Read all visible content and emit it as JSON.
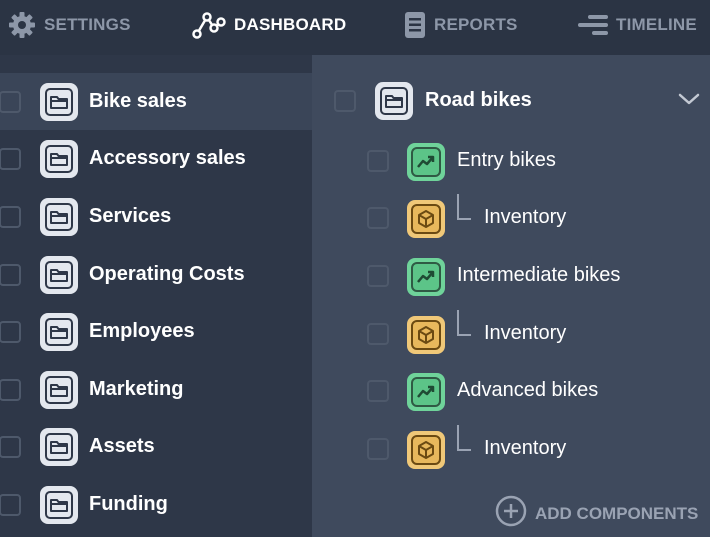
{
  "topnav": {
    "tabs": [
      {
        "label": "SETTINGS",
        "icon": "gear-icon",
        "active": false
      },
      {
        "label": "DASHBOARD",
        "icon": "graph-nodes-icon",
        "active": true
      },
      {
        "label": "REPORTS",
        "icon": "document-icon",
        "active": false
      },
      {
        "label": "TIMELINE",
        "icon": "timeline-icon",
        "active": false
      }
    ]
  },
  "sidebar": {
    "items": [
      {
        "label": "Bike sales",
        "icon": "folder-icon",
        "selected": true
      },
      {
        "label": "Accessory sales",
        "icon": "folder-icon"
      },
      {
        "label": "Services",
        "icon": "folder-icon"
      },
      {
        "label": "Operating Costs",
        "icon": "folder-icon"
      },
      {
        "label": "Employees",
        "icon": "folder-icon"
      },
      {
        "label": "Marketing",
        "icon": "folder-icon"
      },
      {
        "label": "Assets",
        "icon": "folder-icon"
      },
      {
        "label": "Funding",
        "icon": "folder-icon"
      }
    ]
  },
  "detail": {
    "group": {
      "label": "Road bikes",
      "icon": "folder-icon",
      "expanded": true
    },
    "components": [
      {
        "label": "Entry bikes",
        "type": "chart",
        "icon": "trend-chart-icon"
      },
      {
        "label": "Inventory",
        "type": "inventory",
        "icon": "box-icon"
      },
      {
        "label": "Intermediate bikes",
        "type": "chart",
        "icon": "trend-chart-icon"
      },
      {
        "label": "Inventory",
        "type": "inventory",
        "icon": "box-icon"
      },
      {
        "label": "Advanced bikes",
        "type": "chart",
        "icon": "trend-chart-icon"
      },
      {
        "label": "Inventory",
        "type": "inventory",
        "icon": "box-icon"
      }
    ],
    "add_label": "ADD COMPONENTS"
  },
  "colors": {
    "nav_bg": "#2b3444",
    "sidebar_bg": "#2e3748",
    "detail_bg": "#3f4a5d",
    "chart_badge": "#6fd39a",
    "inventory_badge": "#f0c878",
    "muted_text": "#8d97a8"
  }
}
